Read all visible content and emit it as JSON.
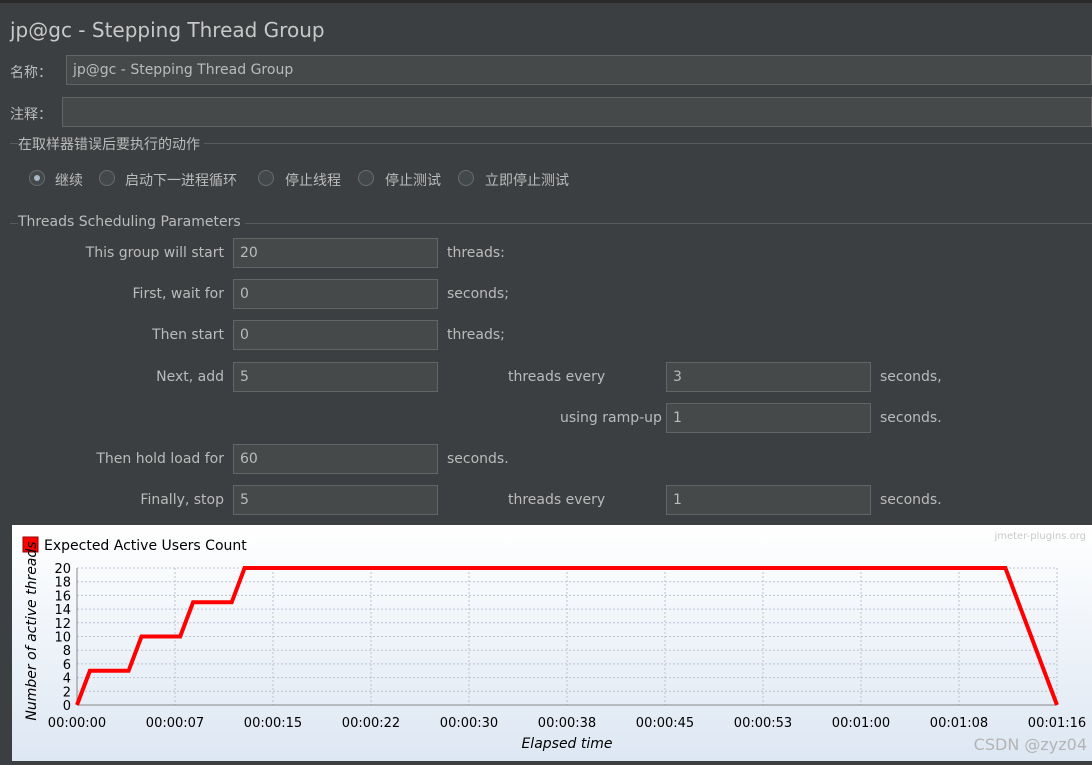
{
  "window": {
    "title": "jp@gc - Stepping Thread Group"
  },
  "name_field": {
    "label": "名称：",
    "value": "jp@gc - Stepping Thread Group"
  },
  "comment_field": {
    "label": "注释：",
    "value": ""
  },
  "on_error": {
    "title": "在取样器错误后要执行的动作",
    "options": [
      {
        "label": "继续",
        "selected": true
      },
      {
        "label": "启动下一进程循环",
        "selected": false
      },
      {
        "label": "停止线程",
        "selected": false
      },
      {
        "label": "停止测试",
        "selected": false
      },
      {
        "label": "立即停止测试",
        "selected": false
      }
    ]
  },
  "params": {
    "title": "Threads Scheduling Parameters",
    "start_label": "This group will start",
    "start_value": "20",
    "start_unit": "threads:",
    "wait_label": "First, wait for",
    "wait_value": "0",
    "wait_unit": "seconds;",
    "then_start_label": "Then start",
    "then_start_value": "0",
    "then_start_unit": "threads;",
    "next_add_label": "Next, add",
    "next_add_value": "5",
    "every_label": "threads every",
    "every_value": "3",
    "every_unit": "seconds,",
    "rampup_label": "using ramp-up",
    "rampup_value": "1",
    "rampup_unit": "seconds.",
    "hold_label": "Then hold load for",
    "hold_value": "60",
    "hold_unit": "seconds.",
    "stop_label": "Finally, stop",
    "stop_value": "5",
    "stop_every_label": "threads every",
    "stop_every_value": "1",
    "stop_every_unit": "seconds."
  },
  "chart_data": {
    "type": "line",
    "legend": "Expected Active Users Count",
    "watermark": "jmeter-plugins.org",
    "xlabel": "Elapsed time",
    "ylabel": "Number of active threads",
    "ylim": [
      0,
      20
    ],
    "yticks": [
      0,
      2,
      4,
      6,
      8,
      10,
      12,
      14,
      16,
      18,
      20
    ],
    "xlim": [
      0,
      76
    ],
    "xtick_values": [
      0,
      7.6,
      15.2,
      22.8,
      30.4,
      38,
      45.6,
      53.2,
      60.8,
      68.4,
      76
    ],
    "xtick_labels": [
      "00:00:00",
      "00:00:07",
      "00:00:15",
      "00:00:22",
      "00:00:30",
      "00:00:38",
      "00:00:45",
      "00:00:53",
      "00:01:00",
      "00:01:08",
      "00:01:16"
    ],
    "line_color": "#ff0000",
    "series": [
      {
        "name": "Expected Active Users Count",
        "x": [
          0,
          1,
          4,
          5,
          8,
          9,
          12,
          13,
          72,
          73,
          73,
          74,
          74,
          75,
          75,
          76
        ],
        "y": [
          0,
          5,
          5,
          10,
          10,
          15,
          15,
          20,
          20,
          15,
          15,
          10,
          10,
          5,
          5,
          0
        ]
      }
    ]
  },
  "credit": "CSDN @zyz04"
}
